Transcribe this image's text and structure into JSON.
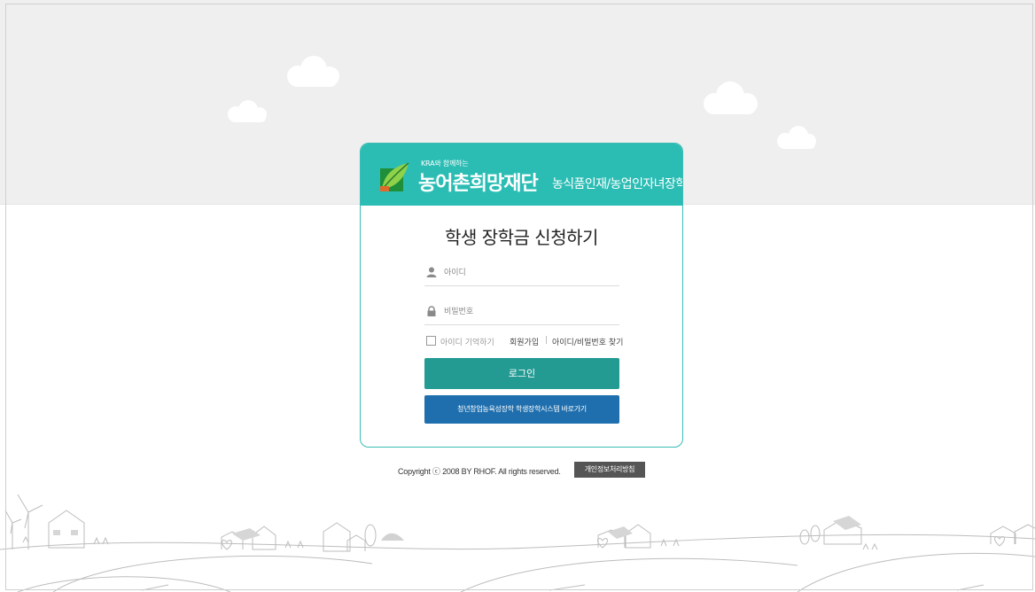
{
  "brand": {
    "small_text": "KRA와 함께하는",
    "main_name": "농어촌희망재단",
    "sub_name": "농식품인재/농업인자녀장학"
  },
  "form": {
    "title": "학생 장학금 신청하기",
    "id_placeholder": "아이디",
    "password_placeholder": "비밀번호",
    "remember_label": "아이디 기억하기",
    "join_link": "회원가입",
    "separator": "|",
    "find_link": "아이디/비밀번호 찾기",
    "login_button": "로그인",
    "system_button": "청년창업농육성장학 학생장학시스템 바로가기"
  },
  "footer": {
    "copyright": "Copyright ⓒ 2008 BY RHOF. All rights reserved.",
    "privacy_link": "개인정보처리방침"
  },
  "colors": {
    "header_teal": "#2bbdb4",
    "login_button": "#239b93",
    "system_button": "#1f6fae",
    "sky": "#efefef"
  },
  "icons": {
    "id_field": "user-icon",
    "password_field": "lock-icon",
    "logo": "leaf-logo-icon"
  }
}
